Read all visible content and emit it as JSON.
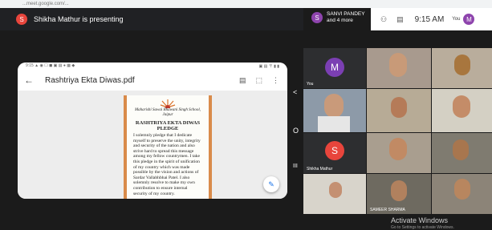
{
  "browser": {
    "url": "...meet.google.com/..."
  },
  "presenter": {
    "initial": "S",
    "text": "Shikha Mathur is presenting"
  },
  "participants": {
    "initial": "S",
    "line1": "SANVI PANDEY",
    "line2": "and 4 more"
  },
  "status": {
    "time": "9:15 AM",
    "you_label": "You",
    "me_initial": "M"
  },
  "phone": {
    "status_left": "9:15 ▲ ◉ ☐ ◼ ▣ ▤ ● ▦ ◆",
    "status_right": "▣ ▤ 〒 ▮ ▮",
    "title": "Rashtriya Ekta Diwas.pdf",
    "back_icon": "←",
    "icons": [
      "▤",
      "⬚",
      "⋮"
    ],
    "pdf": {
      "school": "Maharishi Sawai Bhawani Singh School,",
      "city": "Jaipur",
      "heading1": "RASHTRIYA EKTA DIWAS",
      "heading2": "PLEDGE",
      "body": "I solemnly pledge that I dedicate myself to preserve the unity, integrity and security of the nation and also strive hard to spread this message among my fellow countrymen. I take this pledge in the spirit of unification of my country which was made possible by the vision and actions of Sardar Vallabhbhai Patel. I also solemnly resolve to make my own contribution to ensure internal security of my country."
    }
  },
  "nav": {
    "back": "<",
    "home": "O",
    "recent": "III"
  },
  "tiles": [
    {
      "label": "You",
      "initial": "M"
    },
    {
      "label": ""
    },
    {
      "label": ""
    },
    {
      "label": ""
    },
    {
      "label": ""
    },
    {
      "label": ""
    },
    {
      "label": "Shikha Mathur",
      "initial": "S"
    },
    {
      "label": ""
    },
    {
      "label": ""
    },
    {
      "label": ""
    },
    {
      "label": "SAMEER SHARMA"
    },
    {
      "label": ""
    }
  ],
  "watermark": {
    "title": "Activate Windows",
    "sub": "Go to Settings to activate Windows."
  }
}
